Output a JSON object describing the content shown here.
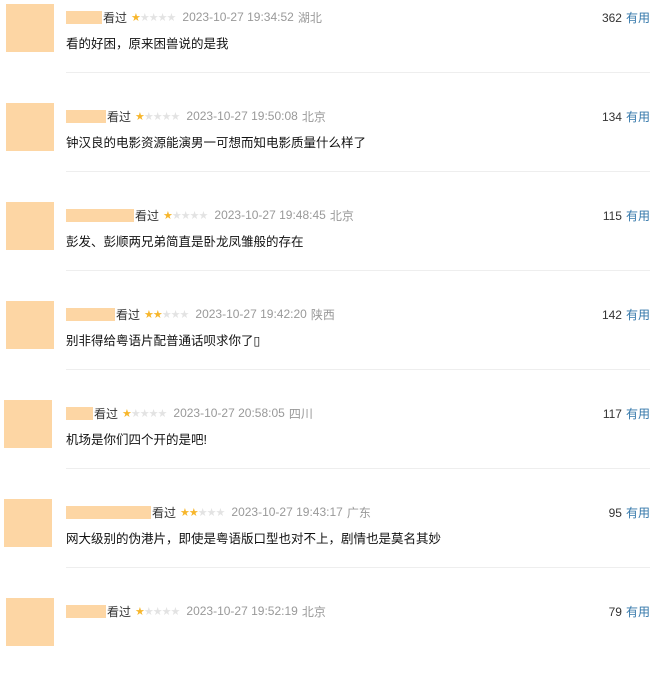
{
  "colors": {
    "avatar_placeholder": "#fdd6a4",
    "star_filled": "#f7b62b",
    "star_empty": "#e3e3e3",
    "meta_gray": "#999999",
    "useful_link": "#3377aa"
  },
  "comments": [
    {
      "status": "看过",
      "rating": 1,
      "time": "2023-10-27 19:34:52",
      "location": "湖北",
      "votes": "362",
      "useful_label": "有用",
      "text": "看的好困，原来困兽说的是我"
    },
    {
      "status": "看过",
      "rating": 1,
      "time": "2023-10-27 19:50:08",
      "location": "北京",
      "votes": "134",
      "useful_label": "有用",
      "text": "钟汉良的电影资源能演男一可想而知电影质量什么样了"
    },
    {
      "status": "看过",
      "rating": 1,
      "time": "2023-10-27 19:48:45",
      "location": "北京",
      "votes": "115",
      "useful_label": "有用",
      "text": "彭发、彭顺两兄弟简直是卧龙凤雏般的存在"
    },
    {
      "status": "看过",
      "rating": 2,
      "time": "2023-10-27 19:42:20",
      "location": "陕西",
      "votes": "142",
      "useful_label": "有用",
      "text": "别非得给粤语片配普通话呗求你了▯"
    },
    {
      "status": "看过",
      "rating": 1,
      "time": "2023-10-27 20:58:05",
      "location": "四川",
      "votes": "117",
      "useful_label": "有用",
      "text": "机场是你们四个开的是吧!"
    },
    {
      "status": "看过",
      "rating": 2,
      "time": "2023-10-27 19:43:17",
      "location": "广东",
      "votes": "95",
      "useful_label": "有用",
      "text": "网大级别的伪港片，即使是粤语版口型也对不上，剧情也是莫名其妙"
    },
    {
      "status": "看过",
      "rating": 1,
      "time": "2023-10-27 19:52:19",
      "location": "北京",
      "votes": "79",
      "useful_label": "有用",
      "text": ""
    }
  ]
}
